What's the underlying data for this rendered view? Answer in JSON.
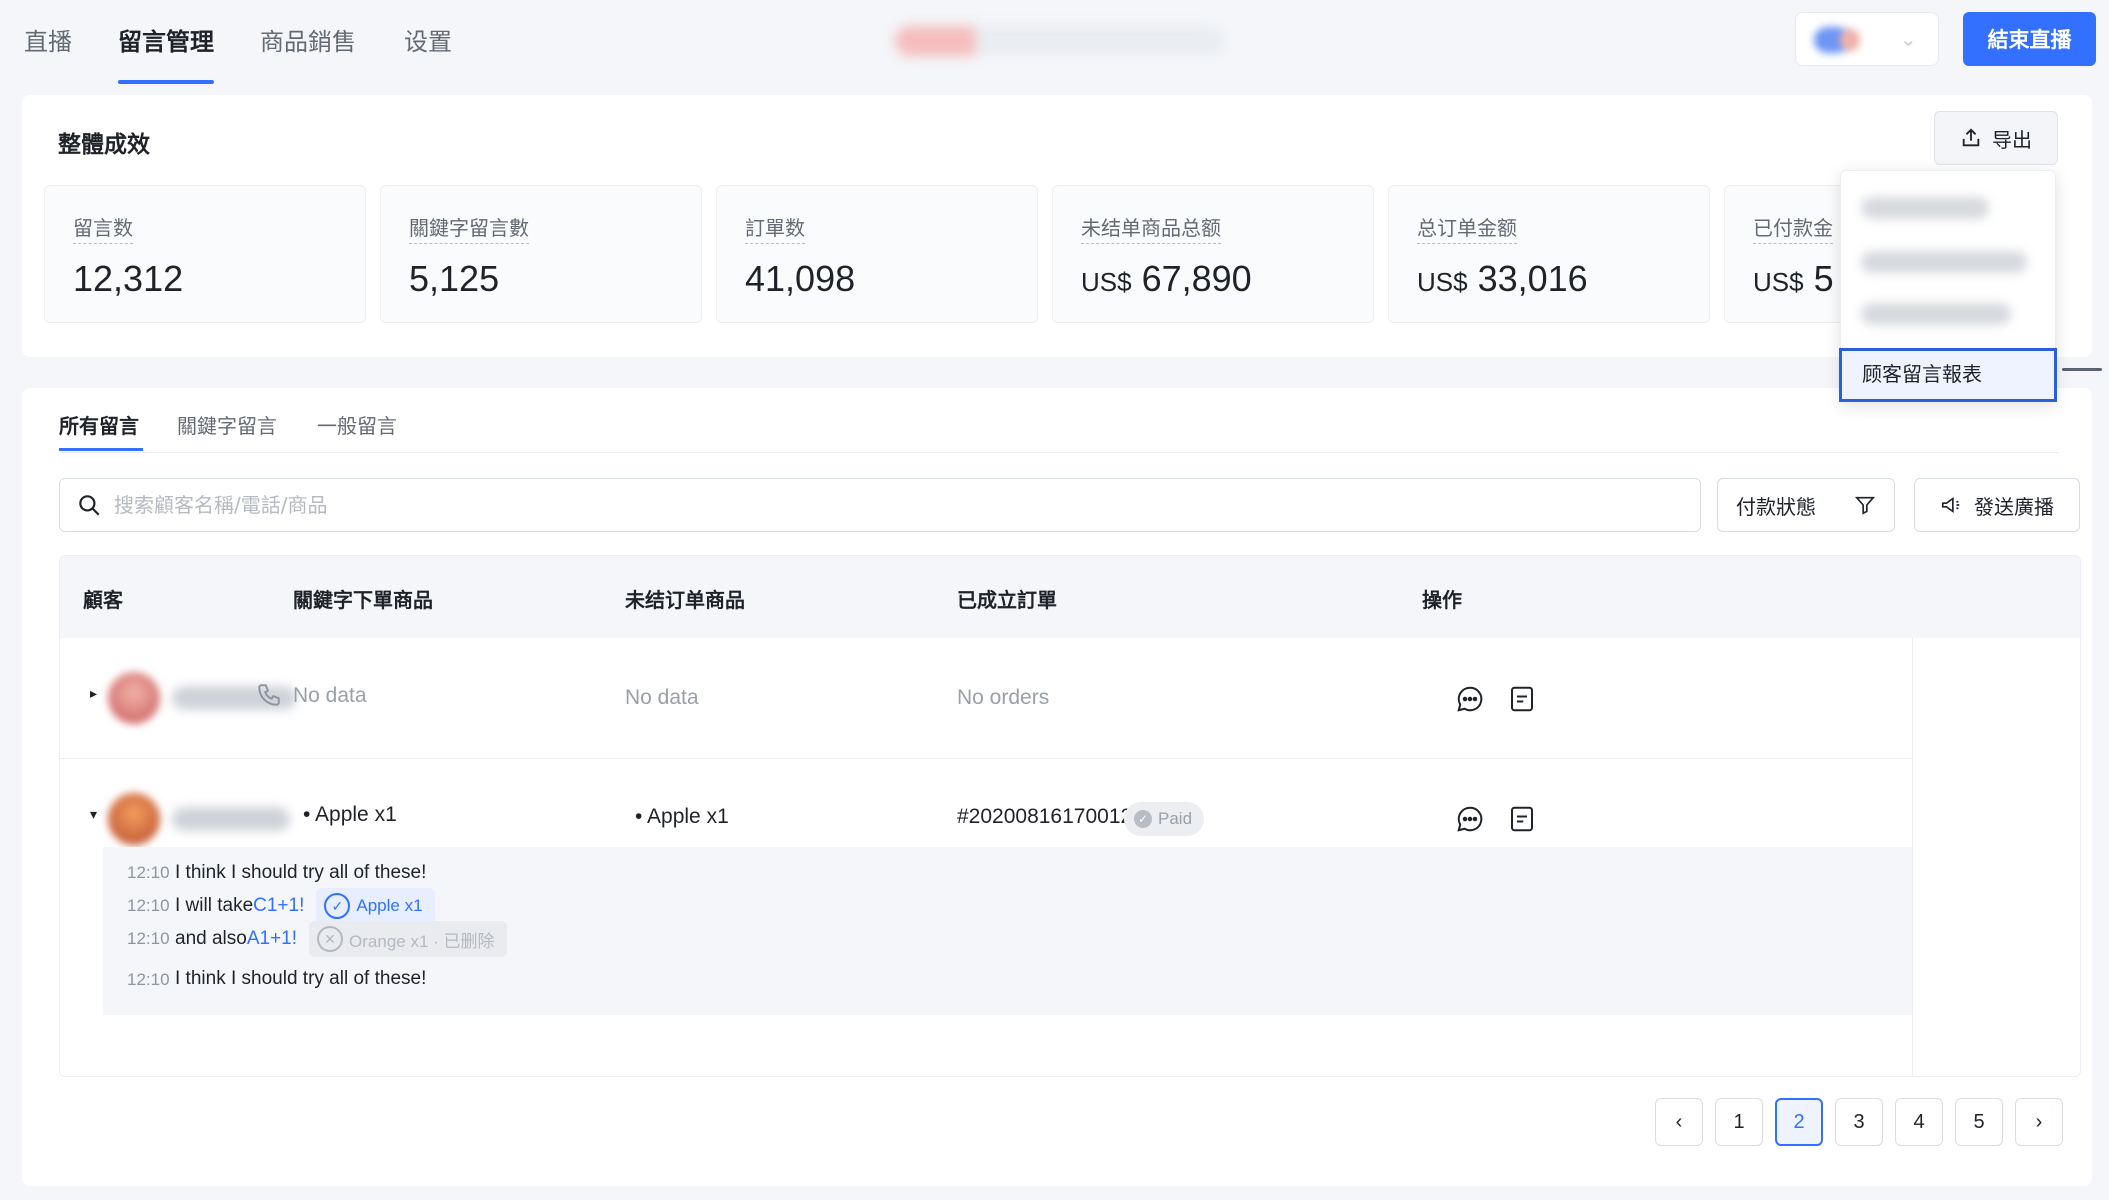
{
  "nav": {
    "tabs": [
      {
        "label": "直播"
      },
      {
        "label": "留言管理"
      },
      {
        "label": "商品銷售"
      },
      {
        "label": "设置"
      }
    ],
    "end_live_label": "結束直播"
  },
  "summary": {
    "title": "整體成效",
    "export_label": "导出",
    "stats": [
      {
        "label": "留言数",
        "currency": "",
        "value": "12,312"
      },
      {
        "label": "關鍵字留言數",
        "currency": "",
        "value": "5,125"
      },
      {
        "label": "訂單数",
        "currency": "",
        "value": "41,098"
      },
      {
        "label": "未结单商品总额",
        "currency": "US$",
        "value": "67,890"
      },
      {
        "label": "总订单金额",
        "currency": "US$",
        "value": "33,016"
      },
      {
        "label": "已付款金",
        "currency": "US$",
        "value": "5"
      }
    ],
    "export_menu": {
      "report_item": "顾客留言報表"
    }
  },
  "messages": {
    "tabs": [
      {
        "label": "所有留言"
      },
      {
        "label": "關鍵字留言"
      },
      {
        "label": "一般留言"
      }
    ],
    "search_placeholder": "搜索顧客名稱/電話/商品",
    "filter_label": "付款狀態",
    "broadcast_label": "發送廣播",
    "table": {
      "headers": [
        "顧客",
        "關鍵字下單商品",
        "未结订单商品",
        "已成立訂單",
        "操作"
      ],
      "rows": [
        {
          "keyword_items": "No data",
          "open_items": "No data",
          "orders": "No orders"
        },
        {
          "keyword_items": "• Apple x1",
          "open_items": "• Apple x1",
          "order_id": "#20200816170012334",
          "order_status": "Paid",
          "chat": [
            {
              "time": "12:10",
              "text": "I think I should try all of these!"
            },
            {
              "time": "12:10",
              "text": "I will take ",
              "keyword": "C1+1!",
              "tag": "Apple x1"
            },
            {
              "time": "12:10",
              "text": "and also ",
              "keyword": "A1+1!",
              "tag": "Orange x1 · 已删除"
            },
            {
              "time": "12:10",
              "text": "I think I should try all of these!"
            }
          ]
        }
      ]
    },
    "pagination": {
      "pages": [
        "1",
        "2",
        "3",
        "4",
        "5"
      ],
      "current": "2"
    }
  },
  "colors": {
    "accent": "#3370ff",
    "text": "#1f2329",
    "muted": "#9aa0a8"
  }
}
